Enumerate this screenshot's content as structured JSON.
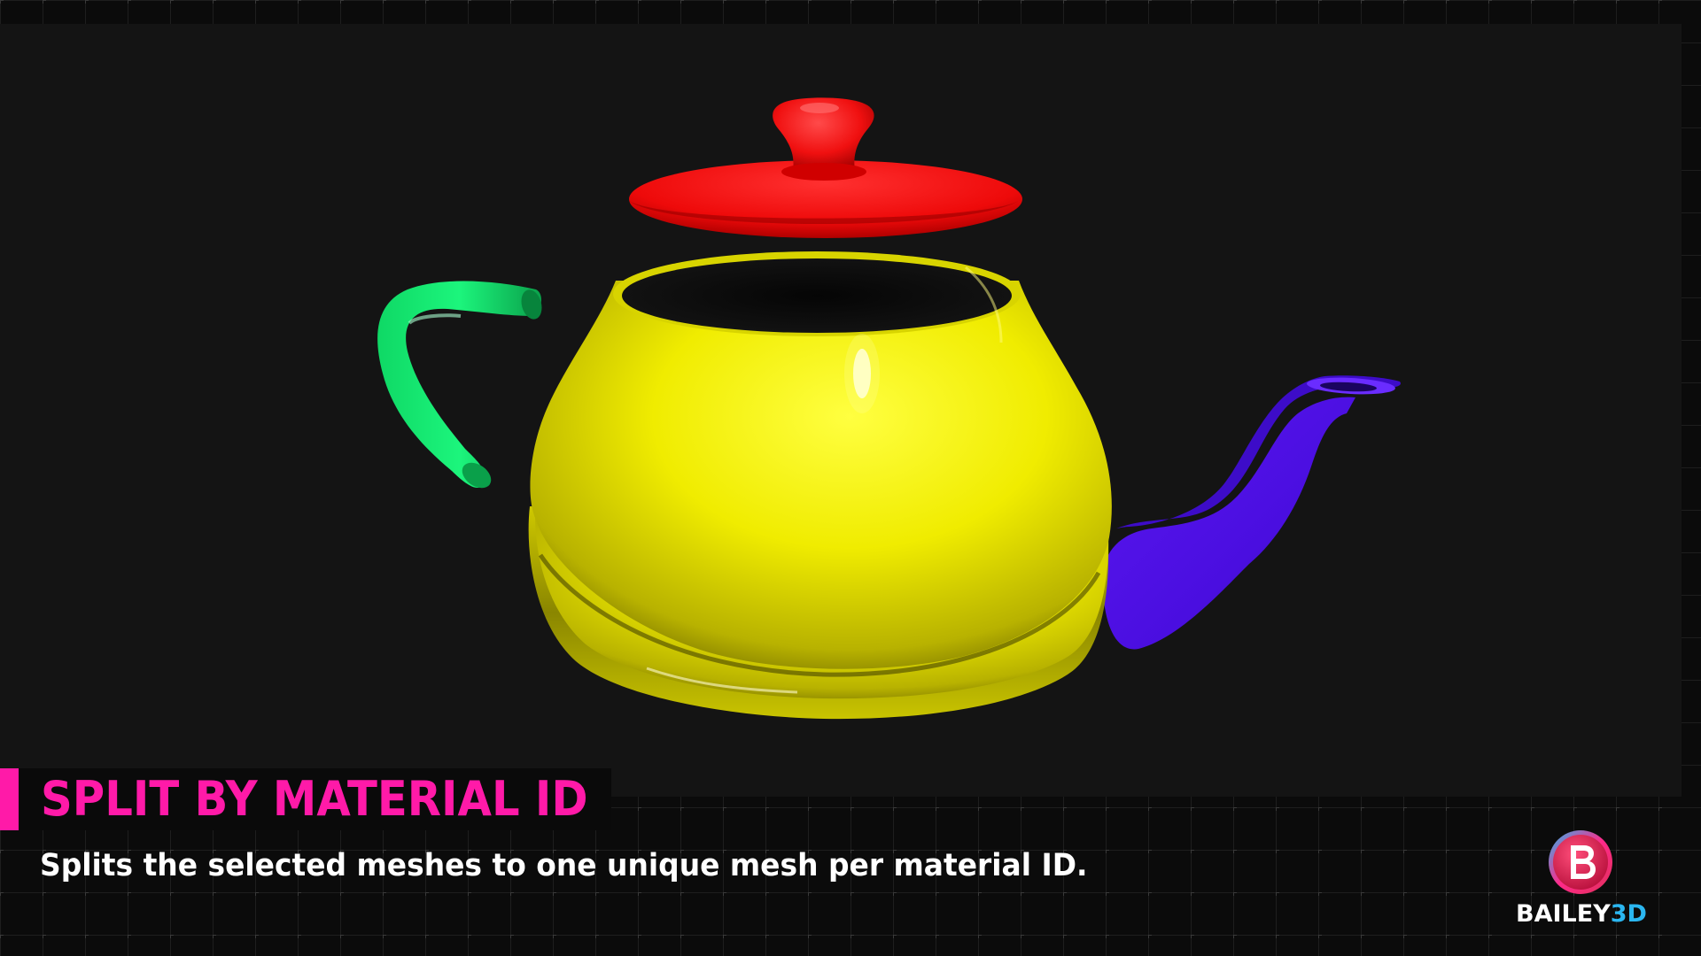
{
  "slide": {
    "title": "SPLIT BY MATERIAL ID",
    "subtitle": "Splits the selected meshes to one unique mesh per material ID."
  },
  "brand": {
    "name_main": "BAILEY",
    "name_accent": "3D",
    "logo_letter": "B"
  },
  "scene": {
    "object": "teapot",
    "parts": [
      {
        "name": "lid",
        "color": "#ff1010"
      },
      {
        "name": "body",
        "color": "#f2f000"
      },
      {
        "name": "handle",
        "color": "#10f070"
      },
      {
        "name": "spout",
        "color": "#4a10e0"
      }
    ]
  },
  "colors": {
    "accent": "#ff1aa8",
    "background": "#141414",
    "brand_accent": "#2bb6f0"
  }
}
